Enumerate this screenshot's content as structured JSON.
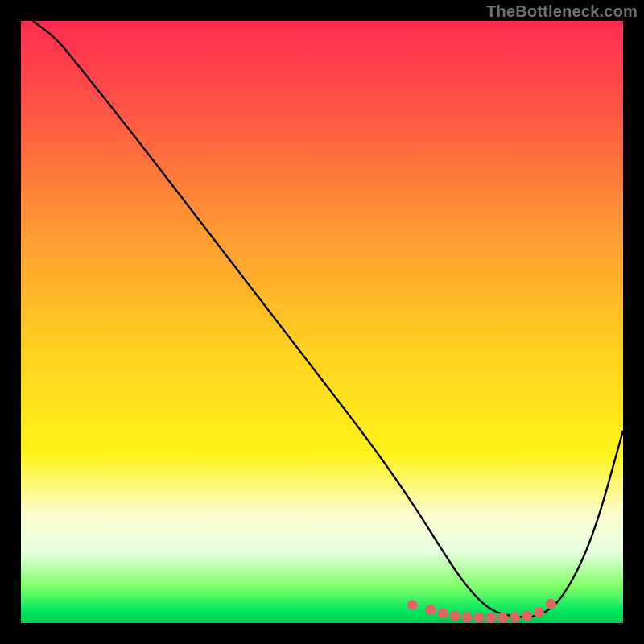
{
  "watermark": "TheBottleneck.com",
  "chart_data": {
    "type": "line",
    "title": "",
    "xlabel": "",
    "ylabel": "",
    "xlim": [
      0,
      100
    ],
    "ylim": [
      0,
      100
    ],
    "grid": false,
    "legend": false,
    "gradient_stops": [
      {
        "offset": 0.0,
        "color": "#ff2b52"
      },
      {
        "offset": 0.15,
        "color": "#ff5544"
      },
      {
        "offset": 0.35,
        "color": "#ff9933"
      },
      {
        "offset": 0.55,
        "color": "#ffd21f"
      },
      {
        "offset": 0.72,
        "color": "#fff31a"
      },
      {
        "offset": 0.82,
        "color": "#fcfccf"
      },
      {
        "offset": 0.88,
        "color": "#e8ffe0"
      },
      {
        "offset": 0.94,
        "color": "#7fff66"
      },
      {
        "offset": 0.98,
        "color": "#00e85e"
      },
      {
        "offset": 1.0,
        "color": "#00c850"
      }
    ],
    "series": [
      {
        "name": "bottleneck-curve",
        "color": "#000000",
        "x": [
          2,
          6,
          10,
          18,
          28,
          38,
          48,
          58,
          65,
          70,
          74,
          78,
          82,
          86,
          90,
          95,
          100
        ],
        "values": [
          100,
          97,
          92,
          82,
          69,
          56,
          43,
          30,
          20,
          12,
          6,
          2,
          1,
          1,
          4,
          14,
          32
        ]
      }
    ],
    "marker_series": {
      "name": "optimal-range-markers",
      "color": "#e06666",
      "x": [
        65,
        68,
        70,
        72,
        74,
        76,
        78,
        80,
        82,
        84,
        86,
        88
      ],
      "values": [
        3.0,
        2.2,
        1.6,
        1.2,
        1.0,
        0.9,
        0.9,
        0.9,
        1.0,
        1.2,
        1.8,
        3.2
      ]
    }
  }
}
